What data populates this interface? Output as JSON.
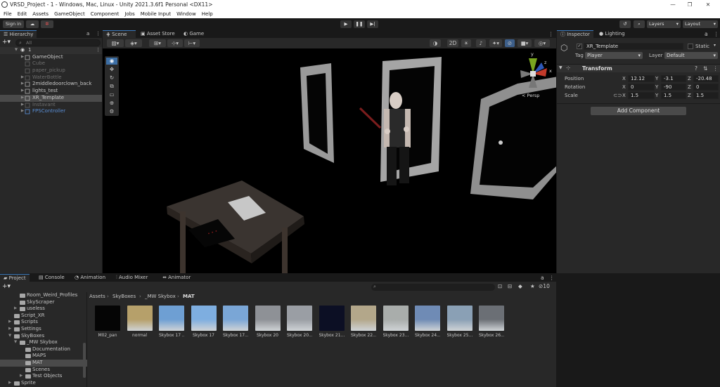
{
  "window": {
    "title": "VRSD_Project - 1 - Windows, Mac, Linux - Unity 2021.3.6f1 Personal <DX11>",
    "minimize": "—",
    "maximize": "❐",
    "close": "✕"
  },
  "menu": [
    "File",
    "Edit",
    "Assets",
    "GameObject",
    "Component",
    "Jobs",
    "Mobile Input",
    "Window",
    "Help"
  ],
  "toolbar": {
    "sign_in": "Sign in",
    "layers": "Layers",
    "layout": "Layout"
  },
  "hierarchy": {
    "tab": "Hierarchy",
    "search_placeholder": "All",
    "scene": "1",
    "items": [
      {
        "label": "GameObject",
        "indent": 1,
        "arrow": true,
        "dim": false
      },
      {
        "label": "Cube",
        "indent": 1,
        "arrow": false,
        "dim": true
      },
      {
        "label": "paper_pickup",
        "indent": 1,
        "arrow": false,
        "dim": true
      },
      {
        "label": "WaterBottle",
        "indent": 1,
        "arrow": true,
        "dim": true
      },
      {
        "label": "2middledoorclown_back",
        "indent": 1,
        "arrow": true,
        "dim": false
      },
      {
        "label": "lights_test",
        "indent": 1,
        "arrow": true,
        "dim": false
      },
      {
        "label": "XR_Template",
        "indent": 1,
        "arrow": true,
        "dim": false,
        "selected": true
      },
      {
        "label": "Instavant",
        "indent": 1,
        "arrow": true,
        "dim": true
      },
      {
        "label": "FPSController",
        "indent": 1,
        "arrow": true,
        "dim": false,
        "blue": true
      }
    ]
  },
  "scene_view": {
    "tabs": [
      "Scene",
      "Asset Store",
      "Game"
    ],
    "btn_2d": "2D",
    "gizmo": {
      "x": "x",
      "y": "y",
      "z": "z",
      "mode": "< Persp"
    }
  },
  "inspector": {
    "tabs": [
      "Inspector",
      "Lighting"
    ],
    "object_name": "XR_Template",
    "static_label": "Static",
    "tag_label": "Tag",
    "tag_value": "Player",
    "layer_label": "Layer",
    "layer_value": "Default",
    "transform_title": "Transform",
    "position": {
      "label": "Position",
      "x": "12.12",
      "y": "-3.1",
      "z": "-20.48"
    },
    "rotation": {
      "label": "Rotation",
      "x": "0",
      "y": "-90",
      "z": "0"
    },
    "scale": {
      "label": "Scale",
      "x": "1.5",
      "y": "1.5",
      "z": "1.5"
    },
    "add_component": "Add Component"
  },
  "project": {
    "tabs": [
      "Project",
      "Console",
      "Animation",
      "Audio Mixer",
      "Animator"
    ],
    "hidden_count": "10",
    "breadcrumb": [
      "Assets",
      "SkyBoxes",
      "_MW Skybox",
      "MAT"
    ],
    "tree": [
      {
        "label": "Room_Weird_Profiles",
        "indent": 1,
        "arrow": false
      },
      {
        "label": "SkyScraper",
        "indent": 1,
        "arrow": false
      },
      {
        "label": "useless",
        "indent": 1,
        "arrow": true
      },
      {
        "label": "Script_XR",
        "indent": 0,
        "arrow": false
      },
      {
        "label": "Scripts",
        "indent": 0,
        "arrow": true
      },
      {
        "label": "Settings",
        "indent": 0,
        "arrow": true
      },
      {
        "label": "SkyBoxes",
        "indent": 0,
        "arrow": true,
        "open": true
      },
      {
        "label": "_MW Skybox",
        "indent": 1,
        "arrow": true,
        "open": true
      },
      {
        "label": "Documentation",
        "indent": 2,
        "arrow": false
      },
      {
        "label": "MAPS",
        "indent": 2,
        "arrow": false
      },
      {
        "label": "MAT",
        "indent": 2,
        "arrow": false,
        "selected": true
      },
      {
        "label": "Scenes",
        "indent": 2,
        "arrow": false
      },
      {
        "label": "Test Objects",
        "indent": 2,
        "arrow": true
      },
      {
        "label": "Sprite",
        "indent": 0,
        "arrow": true
      }
    ],
    "assets": [
      {
        "label": "M02_pan",
        "color": "#050505"
      },
      {
        "label": "normal",
        "color": "#b6a06a"
      },
      {
        "label": "Skybox 17 ...",
        "color": "#6e9fd3"
      },
      {
        "label": "Skybox 17",
        "color": "#7eaee0"
      },
      {
        "label": "Skybox 17...",
        "color": "#7aa6d6"
      },
      {
        "label": "Skybox 20",
        "color": "#8e9196"
      },
      {
        "label": "Skybox 20...",
        "color": "#9a9ea4"
      },
      {
        "label": "Skybox 21...",
        "color": "#0c0f24"
      },
      {
        "label": "Skybox 22...",
        "color": "#b3a78a"
      },
      {
        "label": "Skybox 23...",
        "color": "#a9adab"
      },
      {
        "label": "Skybox 24...",
        "color": "#6f8bb5"
      },
      {
        "label": "Skybox 25...",
        "color": "#8aa0b5"
      },
      {
        "label": "Skybox 26...",
        "color": "#6b6f75"
      }
    ]
  }
}
